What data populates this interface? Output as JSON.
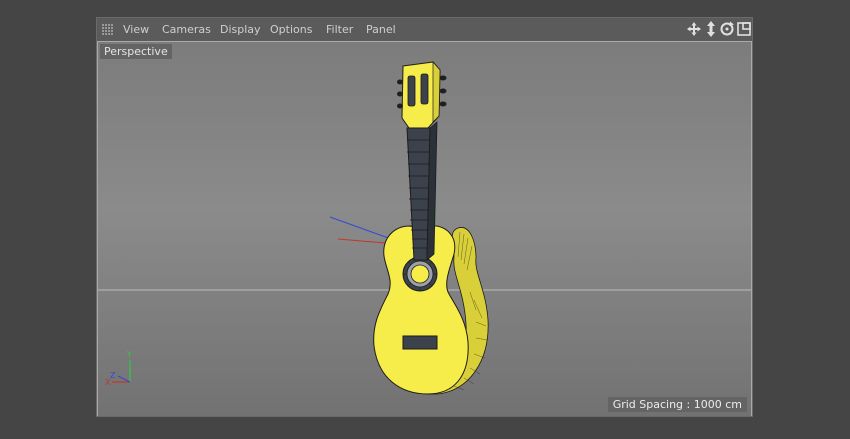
{
  "menu": {
    "items": [
      "View",
      "Cameras",
      "Display",
      "Options",
      "Filter",
      "Panel"
    ]
  },
  "viewport": {
    "camera_label": "Perspective",
    "grid_spacing": "Grid Spacing : 1000 cm"
  },
  "icons": {
    "grip": "grip-icon",
    "move": "move-view-icon",
    "scale": "zoom-view-icon",
    "rotate": "rotate-view-icon",
    "toggle": "toggle-panel-icon"
  },
  "colors": {
    "frame_bg": "#454545",
    "menubar": "#5b5b5b",
    "menu_text": "#cfcfcf",
    "model_yellow": "#f6ec4a",
    "wire": "#1c1c1c",
    "neck_dark": "#3c424b",
    "axis_x": "#c0392b",
    "axis_y": "#2ecc40",
    "axis_z": "#2e4cd6"
  },
  "axis_labels": {
    "x": "X",
    "y": "Y",
    "z": "Z"
  }
}
